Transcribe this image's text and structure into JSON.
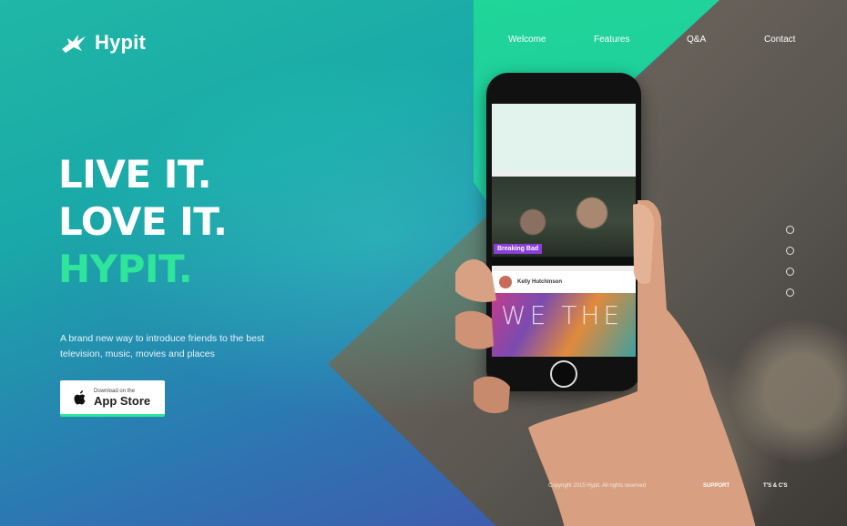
{
  "brand": {
    "name": "Hypit"
  },
  "nav": {
    "items": [
      "Welcome",
      "Features",
      "Q&A",
      "Contact"
    ]
  },
  "hero": {
    "line1": "LIVE IT.",
    "line2": "LOVE IT.",
    "line3": "HYPIT.",
    "tagline": "A brand new way to introduce friends to the best television, music, movies and places"
  },
  "cta": {
    "small": "Download on the",
    "big": "App Store",
    "icon": "apple-icon"
  },
  "phone": {
    "show_tag": "Breaking Bad",
    "user_name": "Kelly Hutchinson",
    "poster_text": "WE THE"
  },
  "pager": {
    "count": 4,
    "active": 0
  },
  "footer": {
    "copyright": "Copyright 2015 Hypit. All rights reserved",
    "support": "SUPPORT",
    "terms": "T'S & C'S"
  },
  "colors": {
    "accent": "#2ee59b",
    "bg_teal": "#1fb7a6",
    "bg_purple": "#4a4aa8"
  }
}
